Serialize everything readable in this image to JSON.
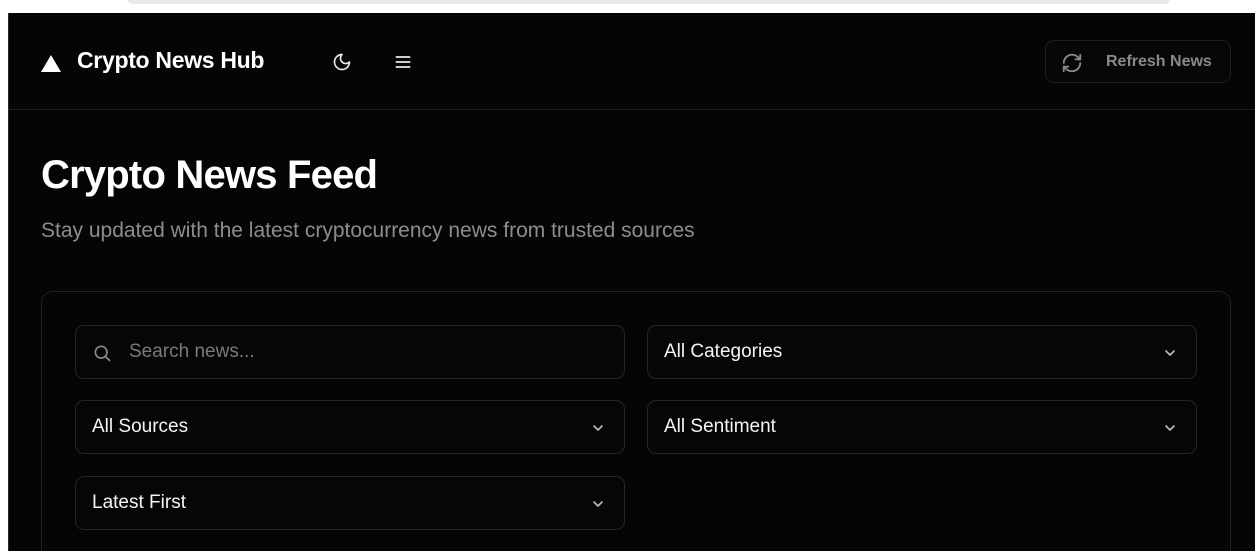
{
  "header": {
    "app_title": "Crypto News Hub",
    "icons": {
      "logo": "triangle-logo-icon",
      "theme": "moon-icon",
      "menu": "hamburger-menu-icon",
      "refresh": "refresh-icon"
    },
    "refresh_label": "Refresh News"
  },
  "main": {
    "title": "Crypto News Feed",
    "subtitle": "Stay updated with the latest cryptocurrency news from trusted sources"
  },
  "filters": {
    "search": {
      "placeholder": "Search news...",
      "value": "",
      "icon": "search-icon"
    },
    "category": {
      "selected": "All Categories"
    },
    "source": {
      "selected": "All Sources"
    },
    "sentiment": {
      "selected": "All Sentiment"
    },
    "sort": {
      "selected": "Latest First"
    },
    "chevron_icon": "chevron-down-icon"
  },
  "colors": {
    "background": "#050505",
    "text_primary": "#ffffff",
    "text_muted": "#8d8d8d",
    "border": "#262626"
  }
}
